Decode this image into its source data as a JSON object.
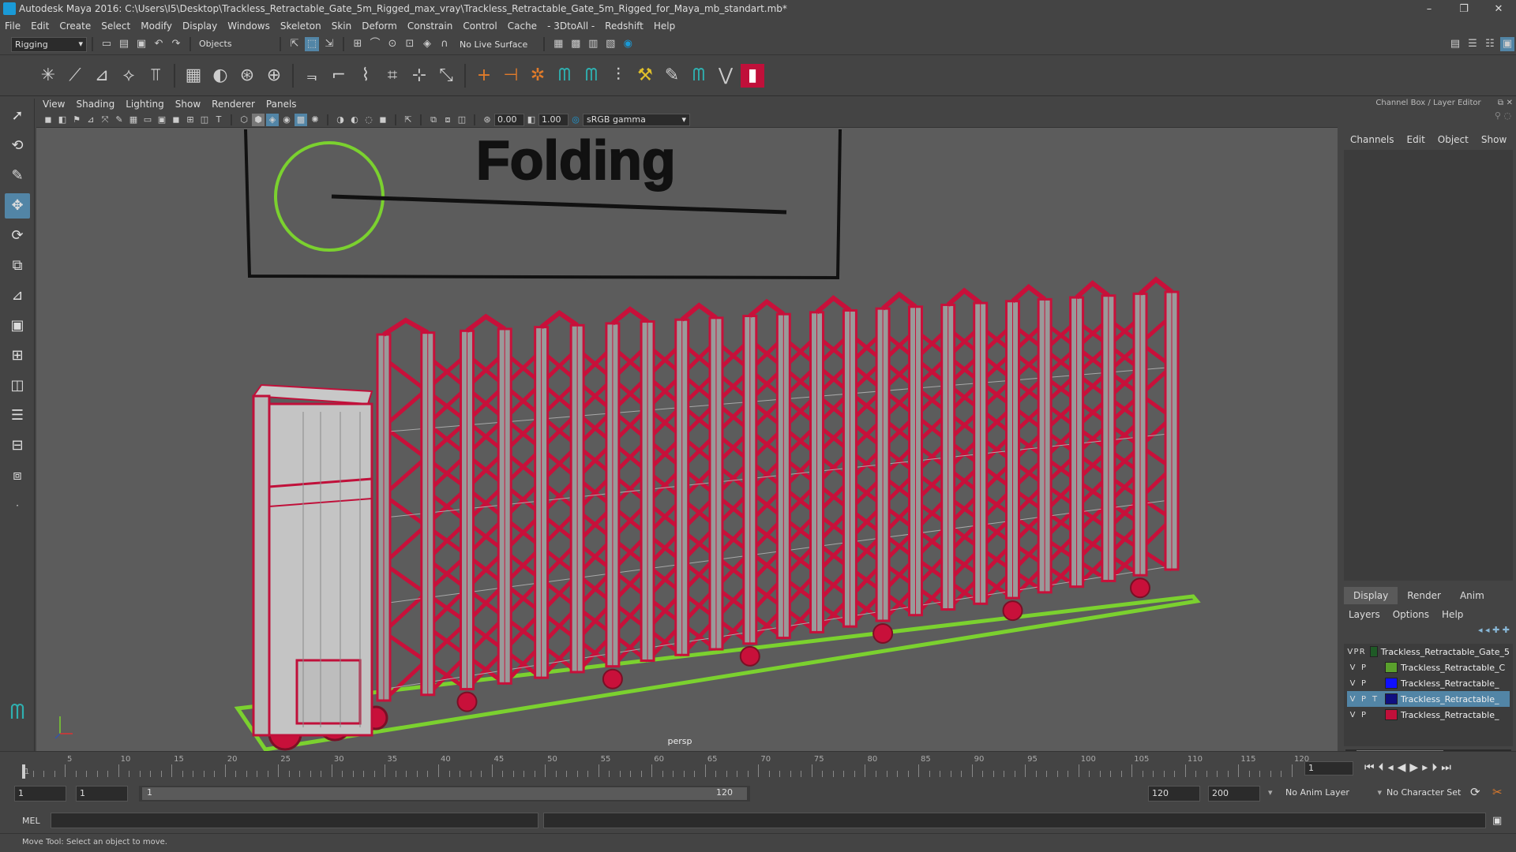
{
  "window": {
    "title": "Autodesk Maya 2016: C:\\Users\\I5\\Desktop\\Trackless_Retractable_Gate_5m_Rigged_max_vray\\Trackless_Retractable_Gate_5m_Rigged_for_Maya_mb_standart.mb*",
    "minimize": "–",
    "maximize": "❐",
    "close": "✕"
  },
  "menubar": [
    "File",
    "Edit",
    "Create",
    "Select",
    "Modify",
    "Display",
    "Windows",
    "Skeleton",
    "Skin",
    "Deform",
    "Constrain",
    "Control",
    "Cache",
    "- 3DtoAll -",
    "Redshift",
    "Help"
  ],
  "statusline": {
    "menuset": "Rigging",
    "selection_mode": "Objects",
    "live_surface": "No Live Surface"
  },
  "panel": {
    "menu": [
      "View",
      "Shading",
      "Lighting",
      "Show",
      "Renderer",
      "Panels"
    ],
    "exposure": "0.00",
    "gamma": "1.00",
    "colorspace": "sRGB gamma",
    "camera_label": "persp"
  },
  "scene": {
    "sign_text": "Folding"
  },
  "channelbox": {
    "header": "Channel Box / Layer Editor",
    "menu": [
      "Channels",
      "Edit",
      "Object",
      "Show"
    ]
  },
  "layer_editor": {
    "tabs": [
      "Display",
      "Render",
      "Anim"
    ],
    "menu": [
      "Layers",
      "Options",
      "Help"
    ],
    "layers": [
      {
        "v": "V",
        "p": "P",
        "x": "R",
        "color": "#1f5a26",
        "name": "Trackless_Retractable_Gate_5",
        "selected": false
      },
      {
        "v": "V",
        "p": "P",
        "x": "",
        "color": "#5aa02c",
        "name": "Trackless_Retractable_C",
        "selected": false
      },
      {
        "v": "V",
        "p": "P",
        "x": "",
        "color": "#1010ff",
        "name": "Trackless_Retractable_",
        "selected": false
      },
      {
        "v": "V",
        "p": "P",
        "x": "T",
        "color": "#101080",
        "name": "Trackless_Retractable_",
        "selected": true
      },
      {
        "v": "V",
        "p": "P",
        "x": "",
        "color": "#c0103a",
        "name": "Trackless_Retractable_",
        "selected": false
      }
    ]
  },
  "timeslider": {
    "ticks": [
      "1",
      "5",
      "10",
      "15",
      "20",
      "25",
      "30",
      "35",
      "40",
      "45",
      "50",
      "55",
      "60",
      "65",
      "70",
      "75",
      "80",
      "85",
      "90",
      "95",
      "100",
      "105",
      "110",
      "115",
      "120"
    ],
    "current_frame": "1"
  },
  "rangeslider": {
    "start": "1",
    "range_start": "1",
    "range_handle_start": "1",
    "range_handle_end": "120",
    "range_end": "120",
    "end": "200",
    "anim_layer": "No Anim Layer",
    "character_set": "No Character Set"
  },
  "cmdline": {
    "label": "MEL"
  },
  "helpline": {
    "text": "Move Tool: Select an object to move."
  }
}
